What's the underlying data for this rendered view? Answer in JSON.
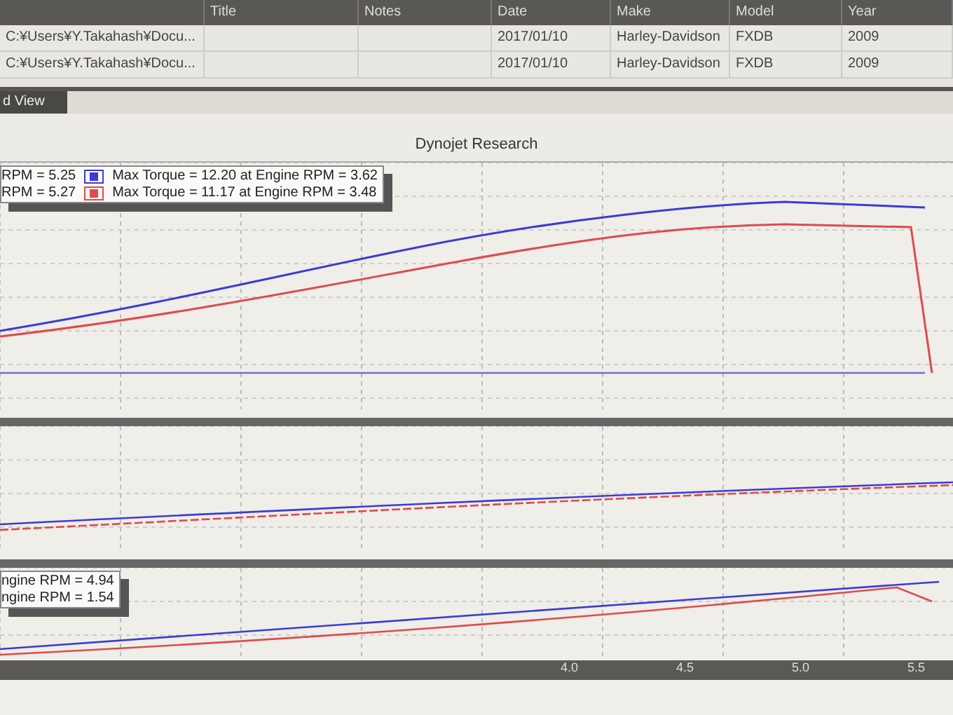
{
  "runs_table": {
    "columns": [
      "Title",
      "Notes",
      "Date",
      "Make",
      "Model",
      "Year"
    ],
    "rows": [
      {
        "file": "C:¥Users¥Y.Takahash¥Docu...",
        "title": "",
        "notes": "",
        "date": "2017/01/10",
        "make": "Harley-Davidson",
        "model": "FXDB",
        "year": "2009"
      },
      {
        "file": "C:¥Users¥Y.Takahash¥Docu...",
        "title": "",
        "notes": "",
        "date": "2017/01/10",
        "make": "Harley-Davidson",
        "model": "FXDB",
        "year": "2009"
      }
    ]
  },
  "view_tab": {
    "label": "d View"
  },
  "graph_title": "Dynojet Research",
  "legend": [
    {
      "left": "RPM = 5.25",
      "text": "Max Torque = 12.20 at Engine RPM = 3.62",
      "color": "#3b3bd8"
    },
    {
      "left": "RPM = 5.27",
      "text": "Max Torque = 11.17 at Engine RPM = 3.48",
      "color": "#e04a4a"
    }
  ],
  "bottom_legend": [
    "ngine RPM = 4.94",
    "ngine RPM = 1.54"
  ],
  "x_axis_labels": [
    "4.0",
    "4.5",
    "5.0",
    "5.5"
  ]
}
